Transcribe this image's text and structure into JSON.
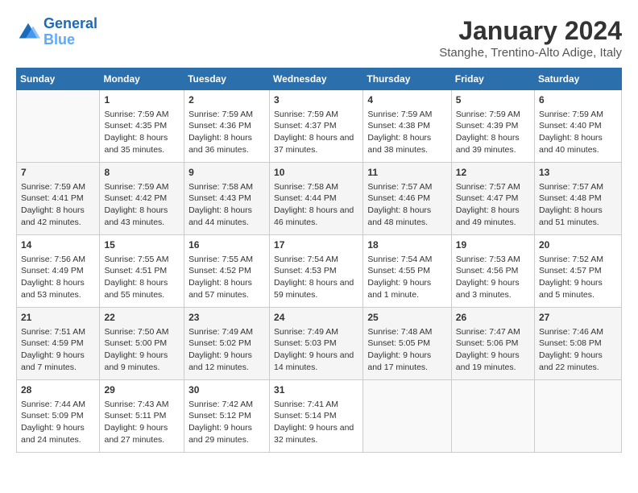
{
  "logo": {
    "line1": "General",
    "line2": "Blue"
  },
  "title": "January 2024",
  "subtitle": "Stanghe, Trentino-Alto Adige, Italy",
  "days_of_week": [
    "Sunday",
    "Monday",
    "Tuesday",
    "Wednesday",
    "Thursday",
    "Friday",
    "Saturday"
  ],
  "weeks": [
    [
      {
        "day": "",
        "content": ""
      },
      {
        "day": "1",
        "sunrise": "Sunrise: 7:59 AM",
        "sunset": "Sunset: 4:35 PM",
        "daylight": "Daylight: 8 hours and 35 minutes."
      },
      {
        "day": "2",
        "sunrise": "Sunrise: 7:59 AM",
        "sunset": "Sunset: 4:36 PM",
        "daylight": "Daylight: 8 hours and 36 minutes."
      },
      {
        "day": "3",
        "sunrise": "Sunrise: 7:59 AM",
        "sunset": "Sunset: 4:37 PM",
        "daylight": "Daylight: 8 hours and 37 minutes."
      },
      {
        "day": "4",
        "sunrise": "Sunrise: 7:59 AM",
        "sunset": "Sunset: 4:38 PM",
        "daylight": "Daylight: 8 hours and 38 minutes."
      },
      {
        "day": "5",
        "sunrise": "Sunrise: 7:59 AM",
        "sunset": "Sunset: 4:39 PM",
        "daylight": "Daylight: 8 hours and 39 minutes."
      },
      {
        "day": "6",
        "sunrise": "Sunrise: 7:59 AM",
        "sunset": "Sunset: 4:40 PM",
        "daylight": "Daylight: 8 hours and 40 minutes."
      }
    ],
    [
      {
        "day": "7",
        "sunrise": "Sunrise: 7:59 AM",
        "sunset": "Sunset: 4:41 PM",
        "daylight": "Daylight: 8 hours and 42 minutes."
      },
      {
        "day": "8",
        "sunrise": "Sunrise: 7:59 AM",
        "sunset": "Sunset: 4:42 PM",
        "daylight": "Daylight: 8 hours and 43 minutes."
      },
      {
        "day": "9",
        "sunrise": "Sunrise: 7:58 AM",
        "sunset": "Sunset: 4:43 PM",
        "daylight": "Daylight: 8 hours and 44 minutes."
      },
      {
        "day": "10",
        "sunrise": "Sunrise: 7:58 AM",
        "sunset": "Sunset: 4:44 PM",
        "daylight": "Daylight: 8 hours and 46 minutes."
      },
      {
        "day": "11",
        "sunrise": "Sunrise: 7:57 AM",
        "sunset": "Sunset: 4:46 PM",
        "daylight": "Daylight: 8 hours and 48 minutes."
      },
      {
        "day": "12",
        "sunrise": "Sunrise: 7:57 AM",
        "sunset": "Sunset: 4:47 PM",
        "daylight": "Daylight: 8 hours and 49 minutes."
      },
      {
        "day": "13",
        "sunrise": "Sunrise: 7:57 AM",
        "sunset": "Sunset: 4:48 PM",
        "daylight": "Daylight: 8 hours and 51 minutes."
      }
    ],
    [
      {
        "day": "14",
        "sunrise": "Sunrise: 7:56 AM",
        "sunset": "Sunset: 4:49 PM",
        "daylight": "Daylight: 8 hours and 53 minutes."
      },
      {
        "day": "15",
        "sunrise": "Sunrise: 7:55 AM",
        "sunset": "Sunset: 4:51 PM",
        "daylight": "Daylight: 8 hours and 55 minutes."
      },
      {
        "day": "16",
        "sunrise": "Sunrise: 7:55 AM",
        "sunset": "Sunset: 4:52 PM",
        "daylight": "Daylight: 8 hours and 57 minutes."
      },
      {
        "day": "17",
        "sunrise": "Sunrise: 7:54 AM",
        "sunset": "Sunset: 4:53 PM",
        "daylight": "Daylight: 8 hours and 59 minutes."
      },
      {
        "day": "18",
        "sunrise": "Sunrise: 7:54 AM",
        "sunset": "Sunset: 4:55 PM",
        "daylight": "Daylight: 9 hours and 1 minute."
      },
      {
        "day": "19",
        "sunrise": "Sunrise: 7:53 AM",
        "sunset": "Sunset: 4:56 PM",
        "daylight": "Daylight: 9 hours and 3 minutes."
      },
      {
        "day": "20",
        "sunrise": "Sunrise: 7:52 AM",
        "sunset": "Sunset: 4:57 PM",
        "daylight": "Daylight: 9 hours and 5 minutes."
      }
    ],
    [
      {
        "day": "21",
        "sunrise": "Sunrise: 7:51 AM",
        "sunset": "Sunset: 4:59 PM",
        "daylight": "Daylight: 9 hours and 7 minutes."
      },
      {
        "day": "22",
        "sunrise": "Sunrise: 7:50 AM",
        "sunset": "Sunset: 5:00 PM",
        "daylight": "Daylight: 9 hours and 9 minutes."
      },
      {
        "day": "23",
        "sunrise": "Sunrise: 7:49 AM",
        "sunset": "Sunset: 5:02 PM",
        "daylight": "Daylight: 9 hours and 12 minutes."
      },
      {
        "day": "24",
        "sunrise": "Sunrise: 7:49 AM",
        "sunset": "Sunset: 5:03 PM",
        "daylight": "Daylight: 9 hours and 14 minutes."
      },
      {
        "day": "25",
        "sunrise": "Sunrise: 7:48 AM",
        "sunset": "Sunset: 5:05 PM",
        "daylight": "Daylight: 9 hours and 17 minutes."
      },
      {
        "day": "26",
        "sunrise": "Sunrise: 7:47 AM",
        "sunset": "Sunset: 5:06 PM",
        "daylight": "Daylight: 9 hours and 19 minutes."
      },
      {
        "day": "27",
        "sunrise": "Sunrise: 7:46 AM",
        "sunset": "Sunset: 5:08 PM",
        "daylight": "Daylight: 9 hours and 22 minutes."
      }
    ],
    [
      {
        "day": "28",
        "sunrise": "Sunrise: 7:44 AM",
        "sunset": "Sunset: 5:09 PM",
        "daylight": "Daylight: 9 hours and 24 minutes."
      },
      {
        "day": "29",
        "sunrise": "Sunrise: 7:43 AM",
        "sunset": "Sunset: 5:11 PM",
        "daylight": "Daylight: 9 hours and 27 minutes."
      },
      {
        "day": "30",
        "sunrise": "Sunrise: 7:42 AM",
        "sunset": "Sunset: 5:12 PM",
        "daylight": "Daylight: 9 hours and 29 minutes."
      },
      {
        "day": "31",
        "sunrise": "Sunrise: 7:41 AM",
        "sunset": "Sunset: 5:14 PM",
        "daylight": "Daylight: 9 hours and 32 minutes."
      },
      {
        "day": "",
        "content": ""
      },
      {
        "day": "",
        "content": ""
      },
      {
        "day": "",
        "content": ""
      }
    ]
  ]
}
